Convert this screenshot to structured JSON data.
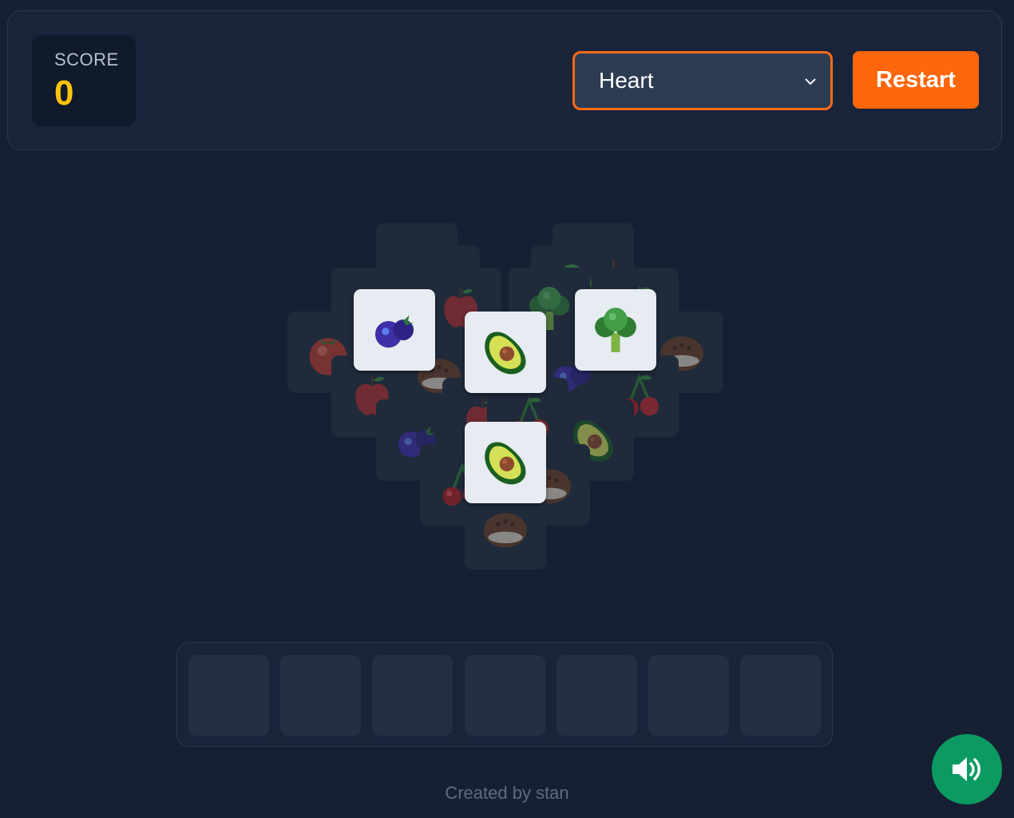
{
  "header": {
    "score_label": "SCORE",
    "score_value": "0",
    "layout_select": {
      "selected": "Heart"
    },
    "restart_label": "Restart"
  },
  "colors": {
    "background": "#172033",
    "accent_orange": "#ff670a",
    "score_yellow": "#fcc30d",
    "sound_green": "#0b9b62",
    "open_tile": "#e7ebf2"
  },
  "board": {
    "shape": "heart",
    "open_tiles": [
      "blueberry",
      "avocado",
      "broccoli",
      "avocado"
    ],
    "covered_tiles": [
      "tomato",
      "apple",
      "coconut",
      "broccoli",
      "tomato",
      "apple",
      "coconut",
      "tomato",
      "blueberry",
      "cherry",
      "blueberry",
      "cherry",
      "avocado",
      "coconut",
      "coconut",
      "cherry",
      "apple",
      "cherry"
    ]
  },
  "tray": {
    "slot_count": 7
  },
  "footer": {
    "credit": "Created by stan"
  },
  "icons": {
    "sound": "speaker-volume-icon",
    "dropdown": "chevron-down-icon"
  }
}
